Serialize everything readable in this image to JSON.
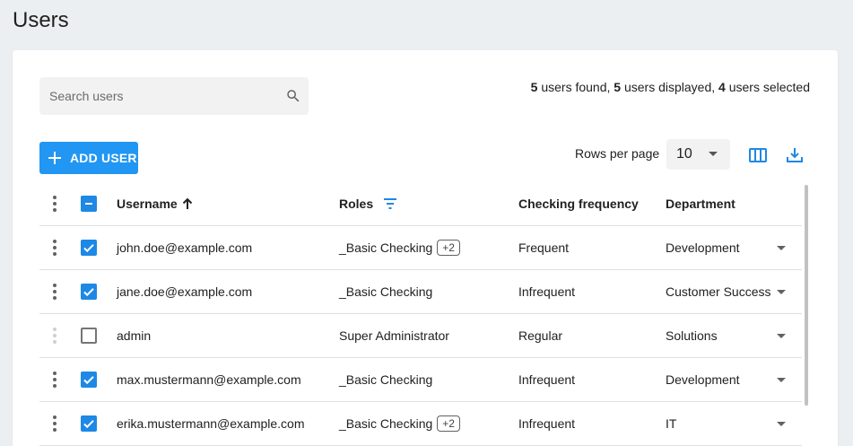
{
  "page": {
    "title": "Users"
  },
  "search": {
    "placeholder": "Search users",
    "value": ""
  },
  "summary": {
    "found_count": "5",
    "found_label": " users found, ",
    "displayed_count": "5",
    "displayed_label": " users displayed, ",
    "selected_count": "4",
    "selected_label": " users selected"
  },
  "toolbar": {
    "add_user_label": "ADD USER",
    "rows_per_page_label": "Rows per page",
    "rows_per_page_value": "10"
  },
  "table": {
    "headers": {
      "username": "Username",
      "roles": "Roles",
      "frequency": "Checking frequency",
      "department": "Department"
    },
    "rows": [
      {
        "username": "john.doe@example.com",
        "role": "_Basic Checking",
        "role_extra": "+2",
        "frequency": "Frequent",
        "department": "Development",
        "selected": true
      },
      {
        "username": "jane.doe@example.com",
        "role": "_Basic Checking",
        "role_extra": "",
        "frequency": "Infrequent",
        "department": "Customer Success",
        "selected": true
      },
      {
        "username": "admin",
        "role": "Super Administrator",
        "role_extra": "",
        "frequency": "Regular",
        "department": "Solutions",
        "selected": false
      },
      {
        "username": "max.mustermann@example.com",
        "role": "_Basic Checking",
        "role_extra": "",
        "frequency": "Infrequent",
        "department": "Development",
        "selected": true
      },
      {
        "username": "erika.mustermann@example.com",
        "role": "_Basic Checking",
        "role_extra": "+2",
        "frequency": "Infrequent",
        "department": "IT",
        "selected": true
      }
    ]
  },
  "colors": {
    "accent": "#2196f3",
    "checkbox": "#1e88e5"
  }
}
